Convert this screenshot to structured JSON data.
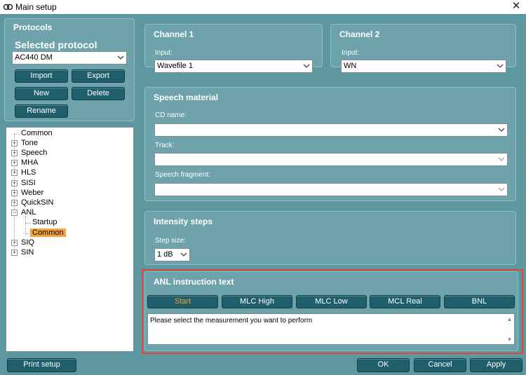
{
  "window": {
    "title": "Main setup"
  },
  "protocols": {
    "heading": "Protocols",
    "selected_heading": "Selected protocol",
    "selected_value": "AC440 DM",
    "buttons": {
      "import": "Import",
      "export": "Export",
      "new": "New",
      "delete": "Delete",
      "rename": "Rename"
    }
  },
  "tree": {
    "items": [
      {
        "label": "Common"
      },
      {
        "label": "Tone"
      },
      {
        "label": "Speech"
      },
      {
        "label": "MHA"
      },
      {
        "label": "HLS"
      },
      {
        "label": "SISI"
      },
      {
        "label": "Weber"
      },
      {
        "label": "QuickSIN"
      },
      {
        "label": "ANL"
      },
      {
        "label": "Startup"
      },
      {
        "label": "Common"
      },
      {
        "label": "SIQ"
      },
      {
        "label": "SIN"
      }
    ],
    "selected": "Common"
  },
  "channel1": {
    "title": "Channel 1",
    "input_label": "Input:",
    "input_value": "Wavefile 1"
  },
  "channel2": {
    "title": "Channel 2",
    "input_label": "Input:",
    "input_value": "WN"
  },
  "speech": {
    "title": "Speech material",
    "cd_label": "CD name:",
    "cd_value": "",
    "track_label": "Track:",
    "track_value": "",
    "fragment_label": "Speech fragment:",
    "fragment_value": ""
  },
  "intensity": {
    "title": "Intensity steps",
    "step_label": "Step size:",
    "step_value": "1 dB"
  },
  "anl": {
    "title": "ANL instruction text",
    "tabs": [
      "Start",
      "MLC High",
      "MLC Low",
      "MCL Real",
      "BNL"
    ],
    "active_tab": "Start",
    "text": "Please select the measurement you want to perform"
  },
  "footer": {
    "print_setup": "Print setup",
    "ok": "OK",
    "cancel": "Cancel",
    "apply": "Apply"
  },
  "colors": {
    "background": "#5d98a1",
    "panel": "#6ea3ac",
    "button": "#1f5f6c",
    "selected": "#f4a340",
    "highlight": "#e0463c"
  }
}
